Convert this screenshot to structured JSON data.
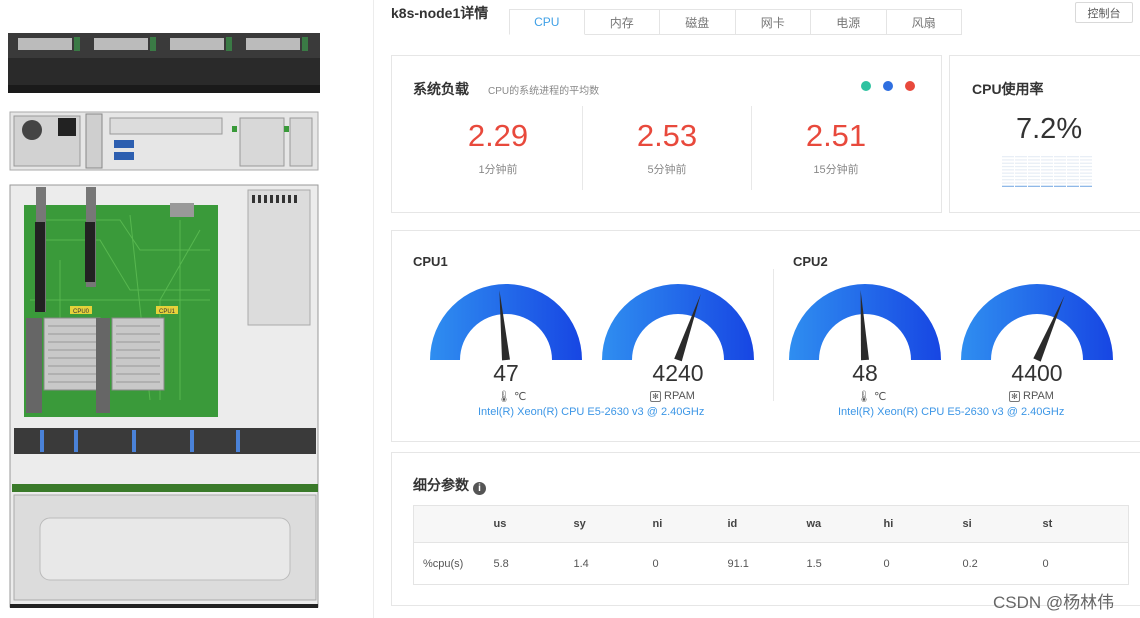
{
  "header": {
    "title": "k8s-node1详情",
    "console_button": "控制台",
    "tabs": [
      "CPU",
      "内存",
      "磁盘",
      "网卡",
      "电源",
      "风扇"
    ],
    "active_tab": "CPU"
  },
  "server": {
    "cpu0_label": "CPU0",
    "cpu1_label": "CPU1"
  },
  "load": {
    "title": "系统负载",
    "subtitle": "CPU的系统进程的平均数",
    "dot_colors": [
      "#2ec2a0",
      "#2f6fe0",
      "#e8493c"
    ],
    "value_color": "#e8493c",
    "items": [
      {
        "value": "2.29",
        "label": "1分钟前"
      },
      {
        "value": "2.53",
        "label": "5分钟前"
      },
      {
        "value": "2.51",
        "label": "15分钟前"
      }
    ]
  },
  "usage": {
    "title": "CPU使用率",
    "value": "7.2%",
    "fraction": 0.072
  },
  "cpus": [
    {
      "name": "CPU1",
      "temperature": {
        "value": "47",
        "unit": "℃",
        "max": 100
      },
      "fan": {
        "value": "4240",
        "unit": "RPAM",
        "max": 7000
      },
      "model": "Intel(R) Xeon(R) CPU E5-2630 v3 @ 2.40GHz"
    },
    {
      "name": "CPU2",
      "temperature": {
        "value": "48",
        "unit": "℃",
        "max": 100
      },
      "fan": {
        "value": "4400",
        "unit": "RPAM",
        "max": 7000
      },
      "model": "Intel(R) Xeon(R) CPU E5-2630 v3 @ 2.40GHz"
    }
  ],
  "details": {
    "title": "细分参数",
    "columns": [
      "",
      "us",
      "sy",
      "ni",
      "id",
      "wa",
      "hi",
      "si",
      "st"
    ],
    "rows": [
      [
        "%cpu(s)",
        "5.8",
        "1.4",
        "0",
        "91.1",
        "1.5",
        "0",
        "0.2",
        "0"
      ]
    ]
  },
  "watermark": "CSDN @杨林伟",
  "colors": {
    "accent": "#3fa0e6",
    "gauge_light": "#2f8ef0",
    "gauge_dark": "#1746e3",
    "board_green": "#3a9a3a"
  }
}
